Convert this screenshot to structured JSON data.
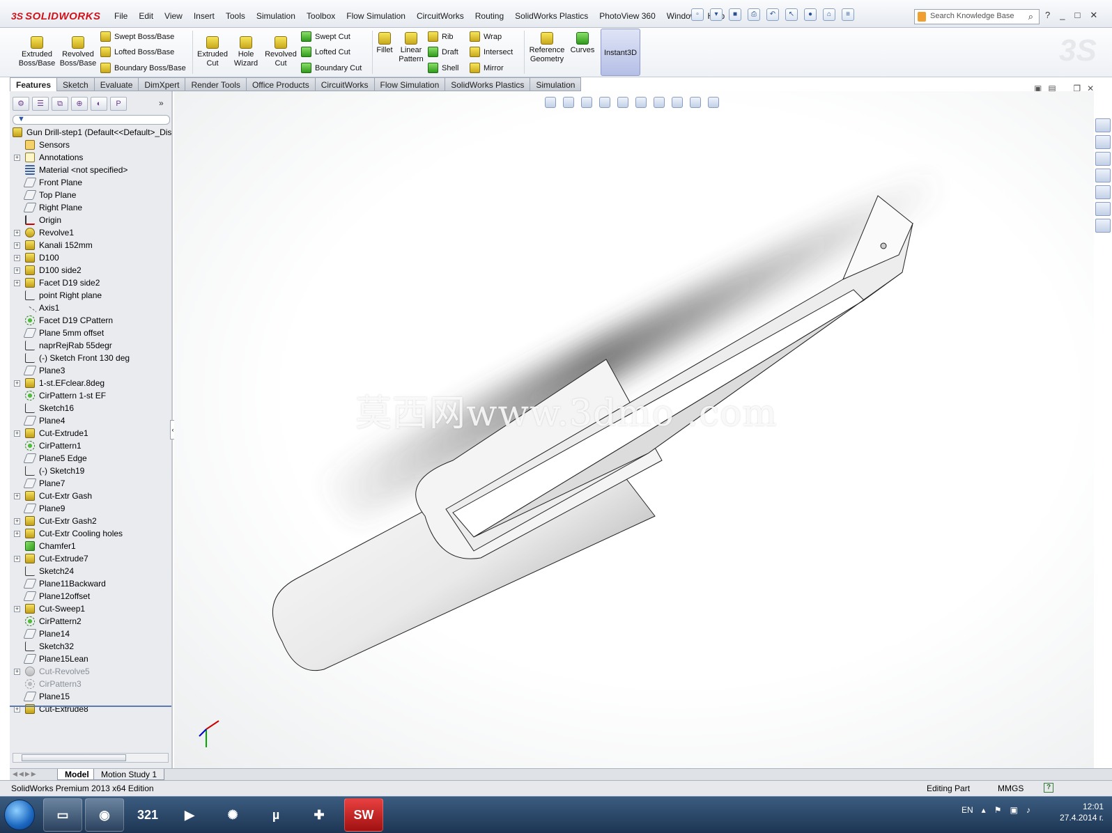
{
  "app": {
    "logo_ds": "3S",
    "logo_name": "SOLIDWORKS",
    "menus": [
      "File",
      "Edit",
      "View",
      "Insert",
      "Tools",
      "Simulation",
      "Toolbox",
      "Flow Simulation",
      "CircuitWorks",
      "Routing",
      "SolidWorks Plastics",
      "PhotoView 360",
      "Window",
      "Help"
    ],
    "search_placeholder": "Search Knowledge Base"
  },
  "commands": {
    "extruded_boss": [
      "Extruded",
      "Boss/Base"
    ],
    "revolved_boss": [
      "Revolved",
      "Boss/Base"
    ],
    "swept_boss": "Swept Boss/Base",
    "lofted_boss": "Lofted Boss/Base",
    "boundary_boss": "Boundary Boss/Base",
    "extruded_cut": [
      "Extruded",
      "Cut"
    ],
    "hole_wizard": [
      "Hole",
      "Wizard"
    ],
    "revolved_cut": [
      "Revolved",
      "Cut"
    ],
    "swept_cut": "Swept Cut",
    "lofted_cut": "Lofted Cut",
    "boundary_cut": "Boundary Cut",
    "fillet": "Fillet",
    "linear_pattern": [
      "Linear",
      "Pattern"
    ],
    "rib": "Rib",
    "draft": "Draft",
    "shell": "Shell",
    "wrap": "Wrap",
    "intersect": "Intersect",
    "mirror": "Mirror",
    "reference_geometry": [
      "Reference",
      "Geometry"
    ],
    "curves": "Curves",
    "instant3d": "Instant3D"
  },
  "tabs": [
    "Features",
    "Sketch",
    "Evaluate",
    "DimXpert",
    "Render Tools",
    "Office Products",
    "CircuitWorks",
    "Flow Simulation",
    "SolidWorks Plastics",
    "Simulation"
  ],
  "tree": {
    "root": "Gun Drill-step1  (Default<<Default>_Dis",
    "items": [
      {
        "label": "Sensors",
        "icon": "sensor",
        "exp": false,
        "dim": false
      },
      {
        "label": "Annotations",
        "icon": "annot",
        "exp": true,
        "dim": false
      },
      {
        "label": "Material <not specified>",
        "icon": "mat",
        "exp": false,
        "dim": false
      },
      {
        "label": "Front Plane",
        "icon": "plane",
        "exp": false,
        "dim": false
      },
      {
        "label": "Top Plane",
        "icon": "plane",
        "exp": false,
        "dim": false
      },
      {
        "label": "Right Plane",
        "icon": "plane",
        "exp": false,
        "dim": false
      },
      {
        "label": "Origin",
        "icon": "origin",
        "exp": false,
        "dim": false
      },
      {
        "label": "Revolve1",
        "icon": "rev",
        "exp": true,
        "dim": false
      },
      {
        "label": "Kanali 152mm",
        "icon": "feat",
        "exp": true,
        "dim": false
      },
      {
        "label": "D100",
        "icon": "feat",
        "exp": true,
        "dim": false
      },
      {
        "label": "D100 side2",
        "icon": "feat",
        "exp": true,
        "dim": false
      },
      {
        "label": "Facet D19 side2",
        "icon": "feat",
        "exp": true,
        "dim": false
      },
      {
        "label": "point Right plane",
        "icon": "sketch",
        "exp": false,
        "dim": false
      },
      {
        "label": "Axis1",
        "icon": "axis",
        "exp": false,
        "dim": false
      },
      {
        "label": "Facet D19 CPattern",
        "icon": "pattern",
        "exp": false,
        "dim": false
      },
      {
        "label": "Plane 5mm offset",
        "icon": "plane",
        "exp": false,
        "dim": false
      },
      {
        "label": "naprRejRab 55degr",
        "icon": "sketch",
        "exp": false,
        "dim": false
      },
      {
        "label": "(-) Sketch Front 130 deg",
        "icon": "sketch",
        "exp": false,
        "dim": false
      },
      {
        "label": "Plane3",
        "icon": "plane",
        "exp": false,
        "dim": false
      },
      {
        "label": "1-st.EFclear.8deg",
        "icon": "feat",
        "exp": true,
        "dim": false
      },
      {
        "label": "CirPattern 1-st EF",
        "icon": "pattern",
        "exp": false,
        "dim": false
      },
      {
        "label": "Sketch16",
        "icon": "sketch",
        "exp": false,
        "dim": false
      },
      {
        "label": "Plane4",
        "icon": "plane",
        "exp": false,
        "dim": false
      },
      {
        "label": "Cut-Extrude1",
        "icon": "feat",
        "exp": true,
        "dim": false
      },
      {
        "label": "CirPattern1",
        "icon": "pattern",
        "exp": false,
        "dim": false
      },
      {
        "label": "Plane5 Edge",
        "icon": "plane",
        "exp": false,
        "dim": false
      },
      {
        "label": "(-) Sketch19",
        "icon": "sketch",
        "exp": false,
        "dim": false
      },
      {
        "label": "Plane7",
        "icon": "plane",
        "exp": false,
        "dim": false
      },
      {
        "label": "Cut-Extr Gash",
        "icon": "feat",
        "exp": true,
        "dim": false
      },
      {
        "label": "Plane9",
        "icon": "plane",
        "exp": false,
        "dim": false
      },
      {
        "label": "Cut-Extr Gash2",
        "icon": "feat",
        "exp": true,
        "dim": false
      },
      {
        "label": "Cut-Extr Cooling holes",
        "icon": "feat",
        "exp": true,
        "dim": false
      },
      {
        "label": "Chamfer1",
        "icon": "chamfer",
        "exp": false,
        "dim": false
      },
      {
        "label": "Cut-Extrude7",
        "icon": "feat",
        "exp": true,
        "dim": false
      },
      {
        "label": "Sketch24",
        "icon": "sketch",
        "exp": false,
        "dim": false
      },
      {
        "label": "Plane11Backward",
        "icon": "plane",
        "exp": false,
        "dim": false
      },
      {
        "label": "Plane12offset",
        "icon": "plane",
        "exp": false,
        "dim": false
      },
      {
        "label": "Cut-Sweep1",
        "icon": "feat",
        "exp": true,
        "dim": false
      },
      {
        "label": "CirPattern2",
        "icon": "pattern",
        "exp": false,
        "dim": false
      },
      {
        "label": "Plane14",
        "icon": "plane",
        "exp": false,
        "dim": false
      },
      {
        "label": "Sketch32",
        "icon": "sketch",
        "exp": false,
        "dim": false
      },
      {
        "label": "Plane15Lean",
        "icon": "plane",
        "exp": false,
        "dim": false
      },
      {
        "label": "Cut-Revolve5",
        "icon": "rev",
        "exp": true,
        "dim": true
      },
      {
        "label": "CirPattern3",
        "icon": "pattern",
        "exp": false,
        "dim": true
      },
      {
        "label": "Plane15",
        "icon": "plane",
        "exp": false,
        "dim": false
      },
      {
        "label": "Cut-Extrude8",
        "icon": "feat",
        "exp": true,
        "dim": false
      }
    ]
  },
  "viewport": {
    "watermark": "莫西网www.3dmo   .com"
  },
  "bottom_tabs": {
    "model": "Model",
    "motion": "Motion Study 1"
  },
  "status": {
    "edition": "SolidWorks Premium 2013 x64 Edition",
    "mode": "Editing Part",
    "units": "MMGS",
    "help": "?"
  },
  "taskbar": {
    "calendar": "321",
    "lang": "EN",
    "time": "12:01",
    "date": "27.4.2014 г."
  },
  "colors": {
    "accent": "#d0141c",
    "instant3d_bg": "#b5bfe6"
  }
}
